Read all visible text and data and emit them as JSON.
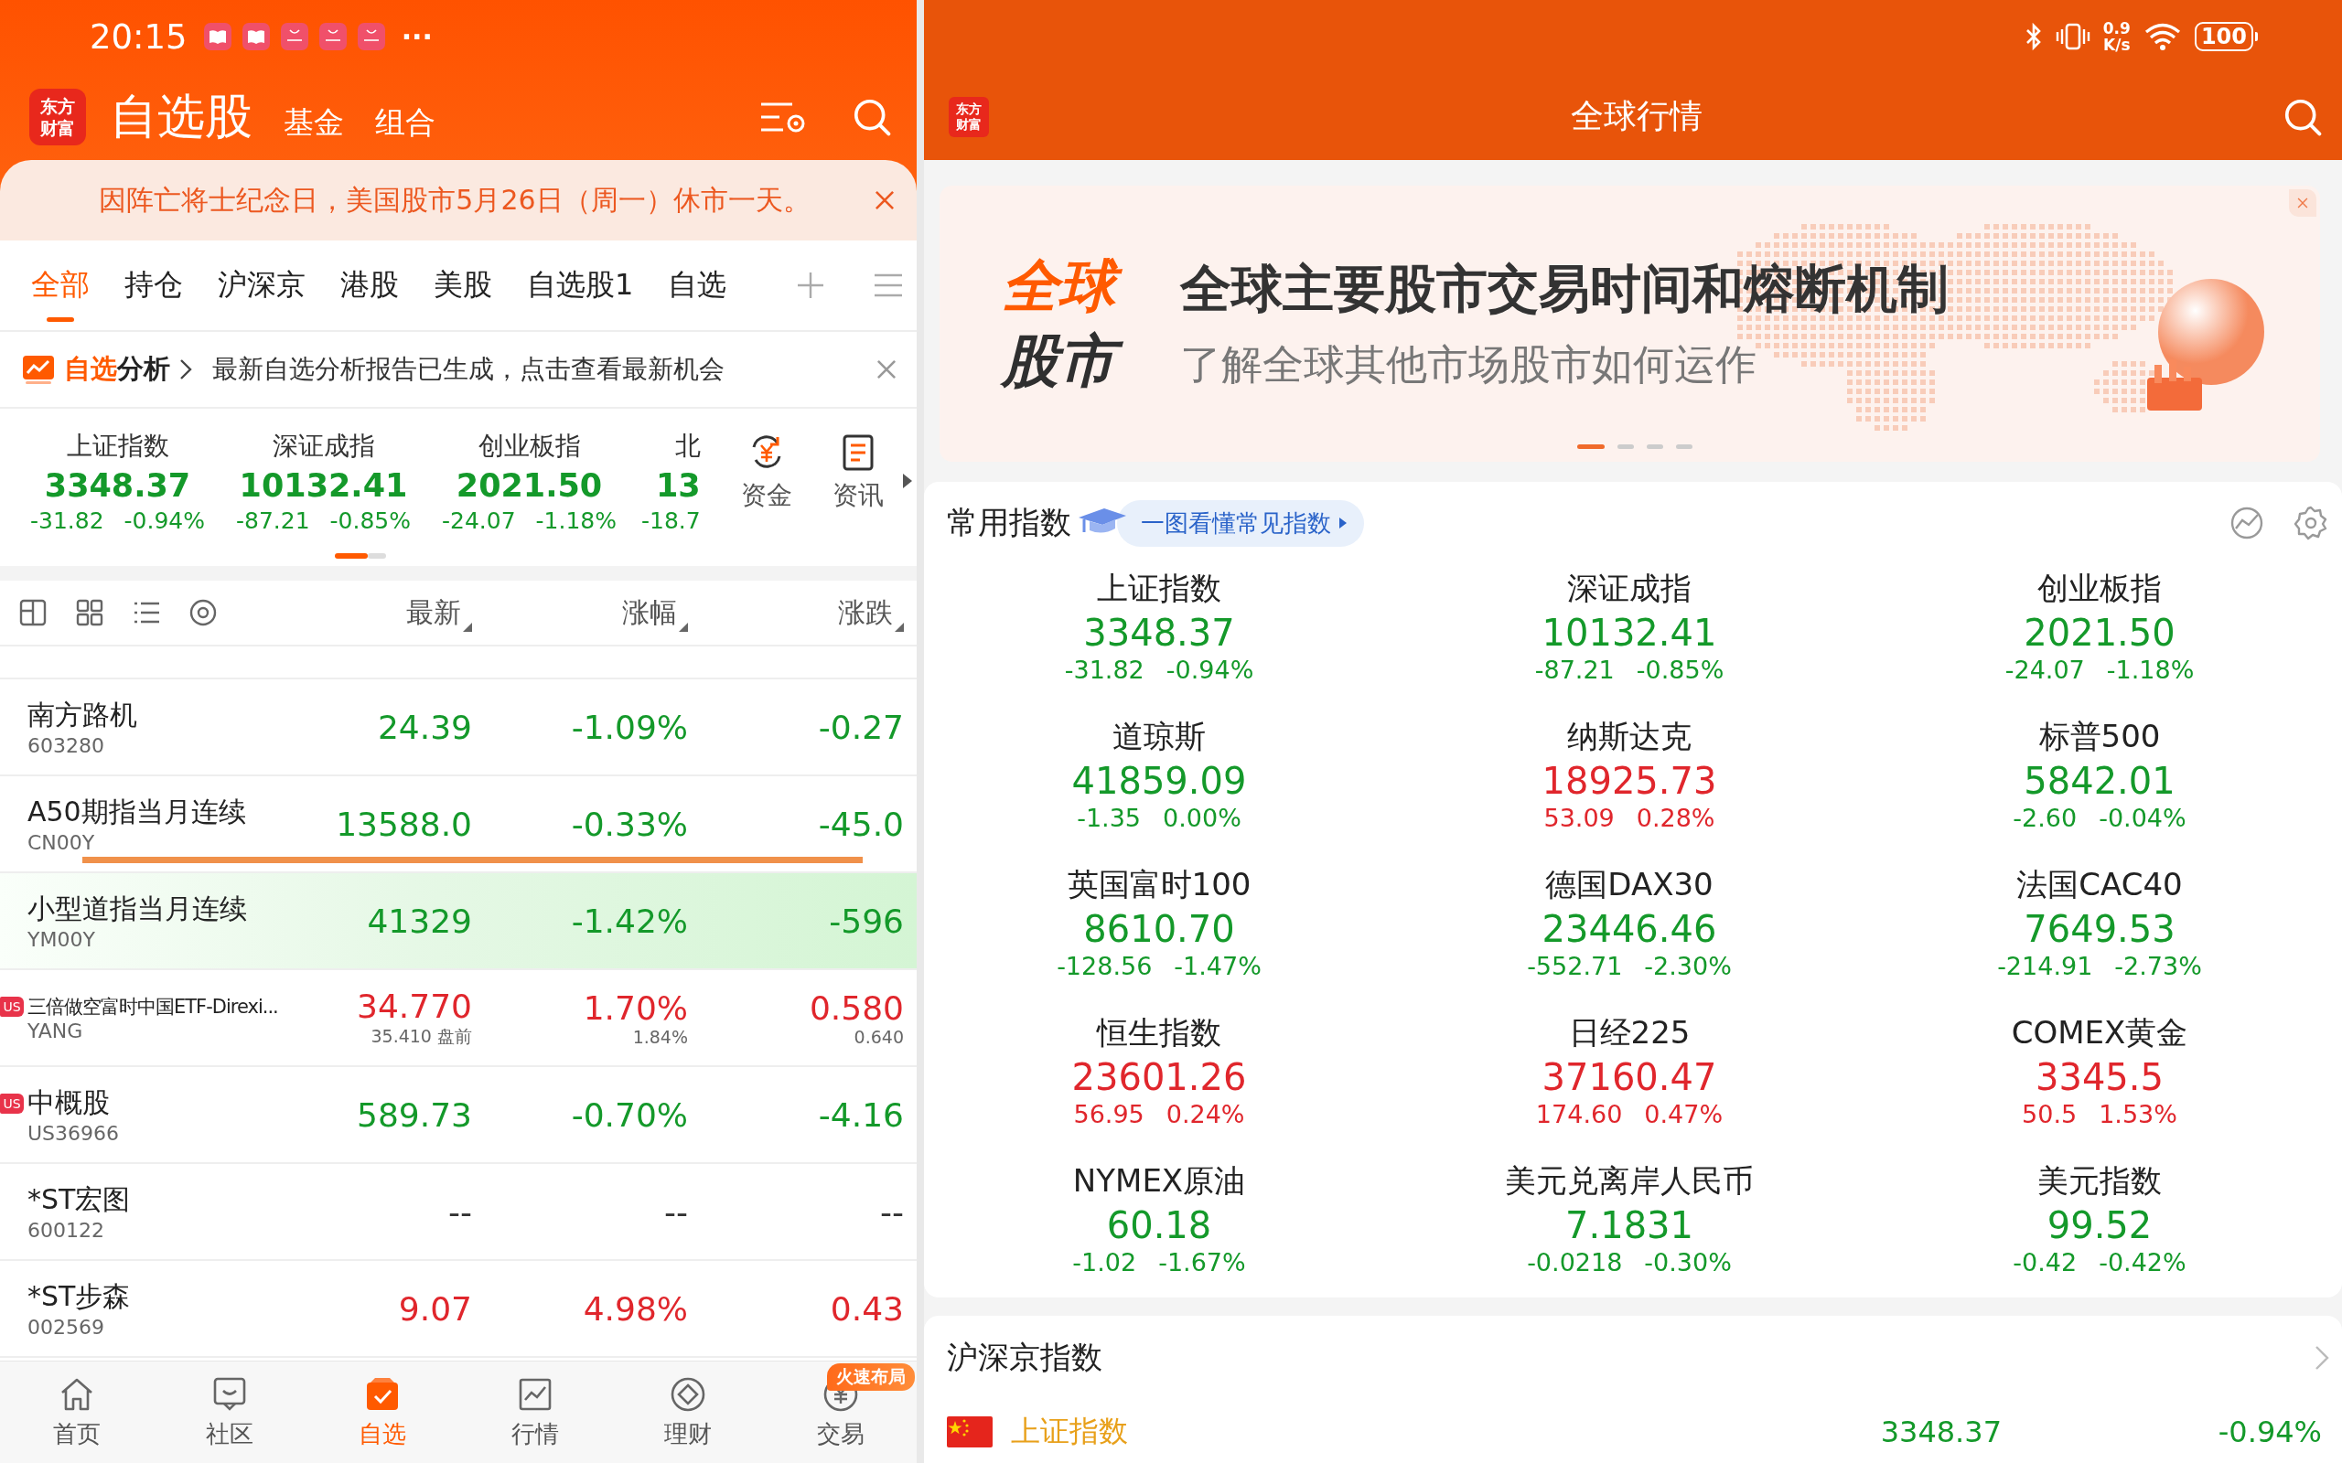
{
  "status_bar": {
    "time": "20:15",
    "more": "···",
    "net_speed": "0.9",
    "net_unit": "K/s",
    "battery": "100"
  },
  "left": {
    "logo": [
      "东方",
      "财富"
    ],
    "header_tabs": [
      {
        "label": "自选股",
        "selected": true
      },
      {
        "label": "基金",
        "selected": false
      },
      {
        "label": "组合",
        "selected": false
      }
    ],
    "notice": {
      "text": "因阵亡将士纪念日，美国股市5月26日（周一）休市一天。"
    },
    "tabs": [
      {
        "label": "全部",
        "selected": true
      },
      {
        "label": "持仓",
        "selected": false
      },
      {
        "label": "沪深京",
        "selected": false
      },
      {
        "label": "港股",
        "selected": false
      },
      {
        "label": "美股",
        "selected": false
      },
      {
        "label": "自选股1",
        "selected": false
      },
      {
        "label": "自选",
        "selected": false
      }
    ],
    "analysis": {
      "highlight": "自选",
      "label": "分析",
      "message": "最新自选分析报告已生成，点击查看最新机会"
    },
    "indices": [
      {
        "name": "上证指数",
        "price": "3348.37",
        "change": "-31.82",
        "pct": "-0.94%",
        "color": "#14992a"
      },
      {
        "name": "深证成指",
        "price": "10132.41",
        "change": "-87.21",
        "pct": "-0.85%",
        "color": "#14992a"
      },
      {
        "name": "创业板指",
        "price": "2021.50",
        "change": "-24.07",
        "pct": "-1.18%",
        "color": "#14992a"
      },
      {
        "name": "北",
        "price": "13",
        "change": "-18.7",
        "color": "#14992a"
      }
    ],
    "shortcuts": [
      {
        "label": "资金",
        "kind": "funds"
      },
      {
        "label": "资讯",
        "kind": "news"
      }
    ],
    "columns": [
      "最新",
      "涨幅",
      "涨跌"
    ],
    "rows": [
      {
        "name": "南方路机",
        "code": "603280",
        "price": "24.39",
        "pct": "-1.09%",
        "change": "-0.27",
        "color": "#14992a",
        "highlighted": false,
        "drop_line": false
      },
      {
        "name": "A50期指当月连续",
        "code": "CN00Y",
        "price": "13588.0",
        "pct": "-0.33%",
        "change": "-45.0",
        "color": "#14992a",
        "highlighted": false,
        "drop_line": true
      },
      {
        "name": "小型道指当月连续",
        "code": "YM00Y",
        "price": "41329",
        "pct": "-1.42%",
        "change": "-596",
        "color": "#14992a",
        "highlighted": true,
        "drop_line": false
      },
      {
        "market": "US",
        "name": "三倍做空富时中国ETF-Direxi...",
        "code": "YANG",
        "price": "34.770",
        "price_sub": "35.410 盘前",
        "pct": "1.70%",
        "pct_sub": "1.84%",
        "change": "0.580",
        "change_sub": "0.640",
        "color": "#e0262c",
        "highlighted": false,
        "drop_line": false
      },
      {
        "market": "US",
        "name": "中概股",
        "code": "US36966",
        "price": "589.73",
        "pct": "-0.70%",
        "change": "-4.16",
        "color": "#14992a",
        "highlighted": false,
        "drop_line": false
      },
      {
        "name": "*ST宏图",
        "code": "600122",
        "price": "--",
        "pct": "--",
        "change": "--",
        "color": "#333333",
        "highlighted": false,
        "drop_line": false
      },
      {
        "name": "*ST步森",
        "code": "002569",
        "price": "9.07",
        "pct": "4.98%",
        "change": "0.43",
        "color": "#e0262c",
        "highlighted": false,
        "drop_line": false
      }
    ],
    "nav": [
      {
        "label": "首页",
        "kind": "home",
        "selected": false
      },
      {
        "label": "社区",
        "kind": "community",
        "selected": false
      },
      {
        "label": "自选",
        "kind": "watchlist",
        "selected": true
      },
      {
        "label": "行情",
        "kind": "market",
        "selected": false
      },
      {
        "label": "理财",
        "kind": "wealth",
        "selected": false
      },
      {
        "label": "交易",
        "kind": "trade",
        "selected": false,
        "badge": "火速布局"
      }
    ]
  },
  "right": {
    "logo": [
      "东方",
      "财富"
    ],
    "title": "全球行情",
    "banner": {
      "brand": [
        "全球",
        "股市"
      ],
      "title": "全球主要股市交易时间和熔断机制",
      "subtitle": "了解全球其他市场股市如何运作",
      "pages": [
        {
          "selected": true
        },
        {
          "selected": false
        },
        {
          "selected": false
        },
        {
          "selected": false
        }
      ]
    },
    "common": {
      "title": "常用指数",
      "link": "一图看懂常见指数",
      "items": [
        {
          "name": "上证指数",
          "price": "3348.37",
          "change": "-31.82",
          "pct": "-0.94%",
          "color": "#14992a"
        },
        {
          "name": "深证成指",
          "price": "10132.41",
          "change": "-87.21",
          "pct": "-0.85%",
          "color": "#14992a"
        },
        {
          "name": "创业板指",
          "price": "2021.50",
          "change": "-24.07",
          "pct": "-1.18%",
          "color": "#14992a"
        },
        {
          "name": "道琼斯",
          "price": "41859.09",
          "change": "-1.35",
          "pct": "0.00%",
          "color": "#14992a"
        },
        {
          "name": "纳斯达克",
          "price": "18925.73",
          "change": "53.09",
          "pct": "0.28%",
          "color": "#e0262c"
        },
        {
          "name": "标普500",
          "price": "5842.01",
          "change": "-2.60",
          "pct": "-0.04%",
          "color": "#14992a"
        },
        {
          "name": "英国富时100",
          "price": "8610.70",
          "change": "-128.56",
          "pct": "-1.47%",
          "color": "#14992a"
        },
        {
          "name": "德国DAX30",
          "price": "23446.46",
          "change": "-552.71",
          "pct": "-2.30%",
          "color": "#14992a"
        },
        {
          "name": "法国CAC40",
          "price": "7649.53",
          "change": "-214.91",
          "pct": "-2.73%",
          "color": "#14992a"
        },
        {
          "name": "恒生指数",
          "price": "23601.26",
          "change": "56.95",
          "pct": "0.24%",
          "color": "#e0262c"
        },
        {
          "name": "日经225",
          "price": "37160.47",
          "change": "174.60",
          "pct": "0.47%",
          "color": "#e0262c"
        },
        {
          "name": "COMEX黄金",
          "price": "3345.5",
          "change": "50.5",
          "pct": "1.53%",
          "color": "#e0262c"
        },
        {
          "name": "NYMEX原油",
          "price": "60.18",
          "change": "-1.02",
          "pct": "-1.67%",
          "color": "#14992a"
        },
        {
          "name": "美元兑离岸人民币",
          "price": "7.1831",
          "change": "-0.0218",
          "pct": "-0.30%",
          "color": "#14992a"
        },
        {
          "name": "美元指数",
          "price": "99.52",
          "change": "-0.42",
          "pct": "-0.42%",
          "color": "#14992a"
        }
      ]
    },
    "region": {
      "title": "沪深京指数",
      "rows": [
        {
          "name": "上证指数",
          "price": "3348.37",
          "pct": "-0.94%",
          "color": "#14992a"
        }
      ]
    }
  }
}
